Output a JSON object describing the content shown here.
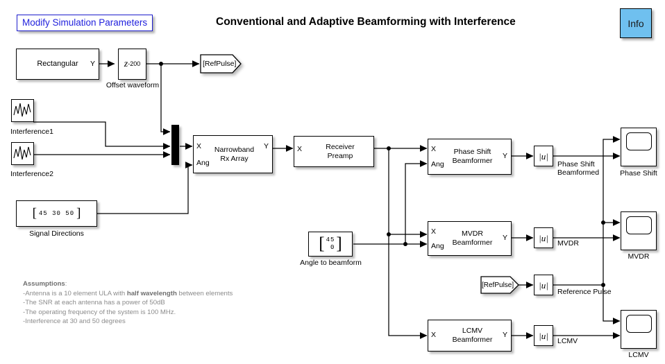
{
  "header": {
    "modify_button": "Modify Simulation Parameters",
    "title": "Conventional and Adaptive Beamforming with Interference",
    "info_button": "Info",
    "modify_border_color": "#2222dd",
    "info_fill_color": "#6fc0ef"
  },
  "blocks": {
    "rectangular": {
      "text": "Rectangular",
      "out_port": "Y"
    },
    "offset_waveform": {
      "text_main": "z",
      "text_exp": "-200",
      "label": "Offset waveform"
    },
    "refpulse_goto": {
      "text": "[RefPulse]"
    },
    "interference1": {
      "label": "Interference1",
      "icon": "random-signal-icon"
    },
    "interference2": {
      "label": "Interference2",
      "icon": "random-signal-icon"
    },
    "signal_directions": {
      "value": "45  30  50",
      "label": "Signal Directions"
    },
    "mux": {
      "name": "mux",
      "inputs": 3
    },
    "narrowband_rx_array": {
      "text": "Narrowband\nRx Array",
      "in1": "X",
      "in2": "Ang",
      "out": "Y"
    },
    "receiver_preamp": {
      "text": "Receiver\nPreamp",
      "in1": "X"
    },
    "angle_to_beamform": {
      "row1": "45",
      "row2": "0",
      "label": "Angle to beamform"
    },
    "phase_shift_beamformer": {
      "text": "Phase Shift\nBeamformer",
      "in1": "X",
      "in2": "Ang",
      "out": "Y"
    },
    "mvdr_beamformer": {
      "text": "MVDR\nBeamformer",
      "in1": "X",
      "in2": "Ang",
      "out": "Y"
    },
    "lcmv_beamformer": {
      "text": "LCMV\nBeamformer",
      "in1": "X",
      "out": "Y"
    },
    "refpulse_from": {
      "text": "[RefPulse]"
    },
    "abs_phase_shift": {
      "text": "|u|"
    },
    "abs_mvdr": {
      "text": "|u|"
    },
    "abs_reference": {
      "text": "|u|"
    },
    "abs_lcmv": {
      "text": "|u|"
    },
    "scope_phase_shift": {
      "label": "Phase Shift"
    },
    "scope_mvdr": {
      "label": "MVDR"
    },
    "scope_lcmv": {
      "label": "LCMV"
    }
  },
  "signal_labels": {
    "phase_shift_beamformed": "Phase Shift\nBeamformed",
    "mvdr": "MVDR",
    "reference_pulse": "Reference Pulse",
    "lcmv": "LCMV"
  },
  "assumptions": {
    "heading": "Assumptions",
    "heading_colon": ":",
    "line1_a": "-Antenna is a 10 element ULA with ",
    "line1_b": "half wavelength",
    "line1_c": " between elements",
    "line2": "-The SNR at each antenna has  a power of 50dB",
    "line3": "-The operating frequency of the system is 100 MHz.",
    "line4": "-Interference at 30 and 50 degrees"
  }
}
